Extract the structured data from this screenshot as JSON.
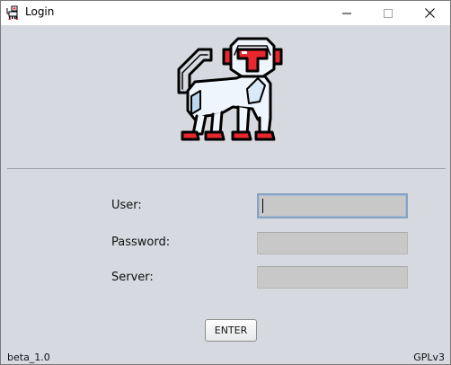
{
  "window": {
    "title": "Login",
    "minimize_glyph": "—",
    "maximize_glyph": "☐",
    "close_glyph": "✕"
  },
  "form": {
    "user_label": "User:",
    "password_label": "Password:",
    "server_label": "Server:",
    "user_value": "",
    "password_value": "",
    "server_value": "",
    "enter_label": "ENTER"
  },
  "footer": {
    "version": "beta_1.0",
    "license": "GPLv3"
  },
  "icons": {
    "app": "robot-monkey-icon",
    "logo": "robot-monkey-logo"
  },
  "colors": {
    "background": "#d6d9df",
    "accent_red": "#e8282e",
    "focus_border": "#86a3c2"
  }
}
